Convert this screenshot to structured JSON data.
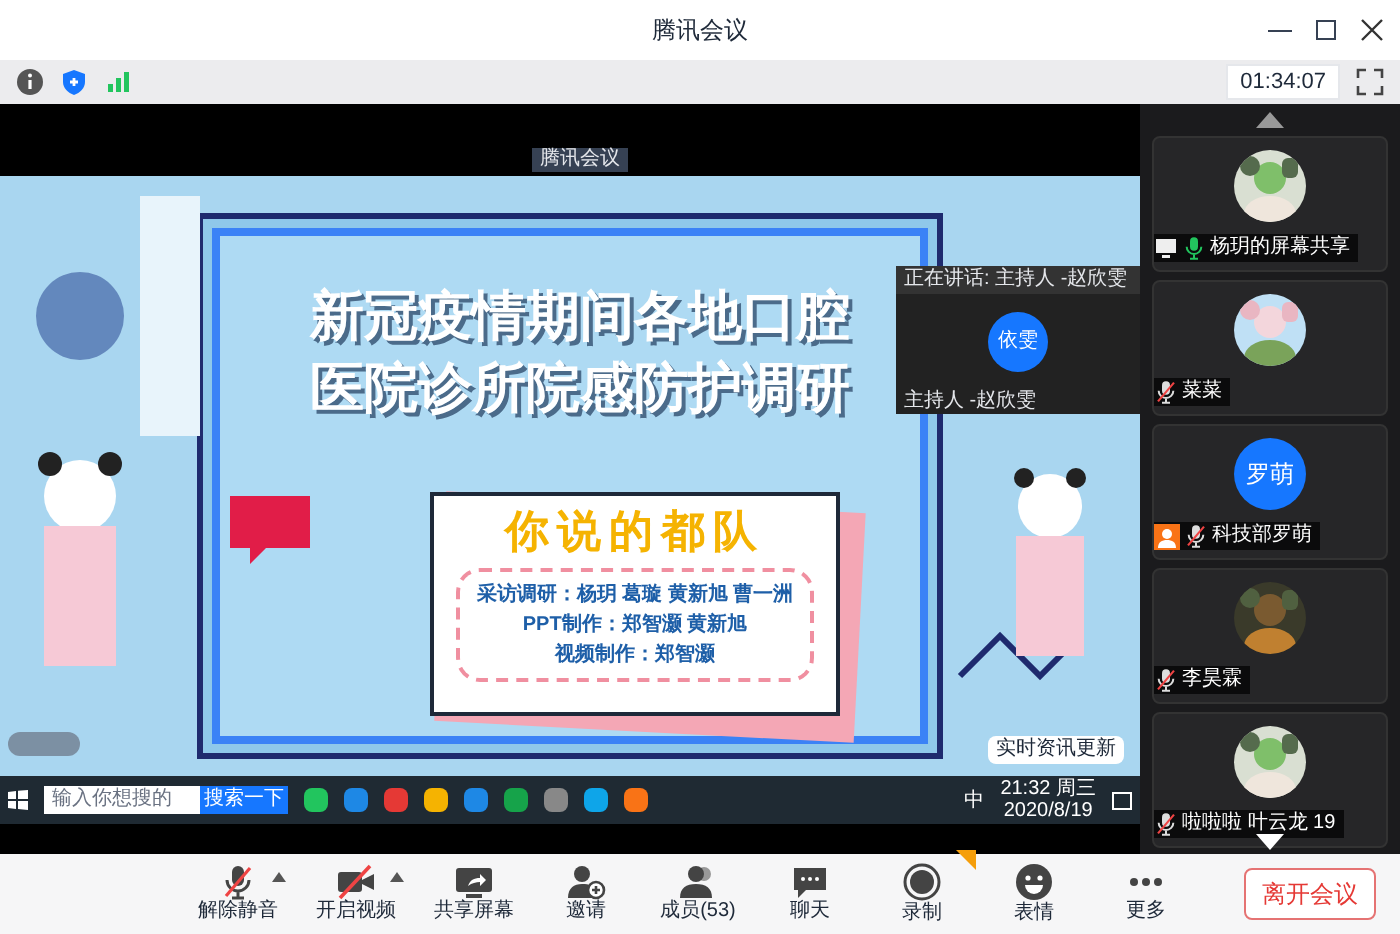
{
  "window": {
    "title": "腾讯会议"
  },
  "info_bar": {
    "timer": "01:34:07"
  },
  "shared_screen": {
    "meeting_label": "腾讯会议",
    "slide": {
      "title_lines": [
        "新冠疫情期间各地口腔",
        "医院诊所院感防护调研"
      ],
      "card_title": "你说的都队",
      "credits": [
        "采访调研：杨玥 葛璇 黄新旭 曹一洲",
        "PPT制作：郑智灏 黄新旭",
        "视频制作：郑智灏"
      ]
    },
    "speaker_window": {
      "header": "正在讲话: 主持人 -赵欣雯",
      "avatar": "依雯",
      "name": "主持人 -赵欣雯"
    },
    "news_popup": {
      "label": "实时资讯更新"
    },
    "taskbar": {
      "search_placeholder": "输入你想搜的",
      "search_button": "搜索一下",
      "ime": "中",
      "time": "21:32 周三",
      "date": "2020/8/19"
    }
  },
  "participants": [
    {
      "name": "杨玥的屏幕共享",
      "muted": false,
      "sharing": true,
      "host": false
    },
    {
      "name": "菜菜",
      "muted": true,
      "sharing": false,
      "host": false
    },
    {
      "name": "科技部罗萌",
      "avatar": {
        "kind": "initials",
        "text": "罗萌"
      },
      "muted": true,
      "sharing": false,
      "host": true
    },
    {
      "name": "李昊霖",
      "muted": true,
      "sharing": false,
      "host": false
    },
    {
      "name": "啦啦啦 叶云龙 19",
      "muted": true,
      "sharing": false,
      "host": false
    }
  ],
  "toolbar": [
    {
      "label": "解除静音",
      "off": true,
      "menu": true,
      "badge": false
    },
    {
      "label": "开启视频",
      "off": true,
      "menu": true,
      "badge": false
    },
    {
      "label": "共享屏幕",
      "off": false,
      "menu": false,
      "badge": false
    },
    {
      "label": "邀请",
      "off": false,
      "menu": false,
      "badge": false
    },
    {
      "label": "成员(53)",
      "off": false,
      "menu": false,
      "badge": false
    },
    {
      "label": "聊天",
      "off": false,
      "menu": false,
      "badge": false
    },
    {
      "label": "录制",
      "off": false,
      "menu": false,
      "badge": true
    },
    {
      "label": "表情",
      "off": false,
      "menu": false,
      "badge": false
    },
    {
      "label": "更多",
      "off": false,
      "menu": false,
      "badge": false
    }
  ],
  "leave_button": "离开会议"
}
